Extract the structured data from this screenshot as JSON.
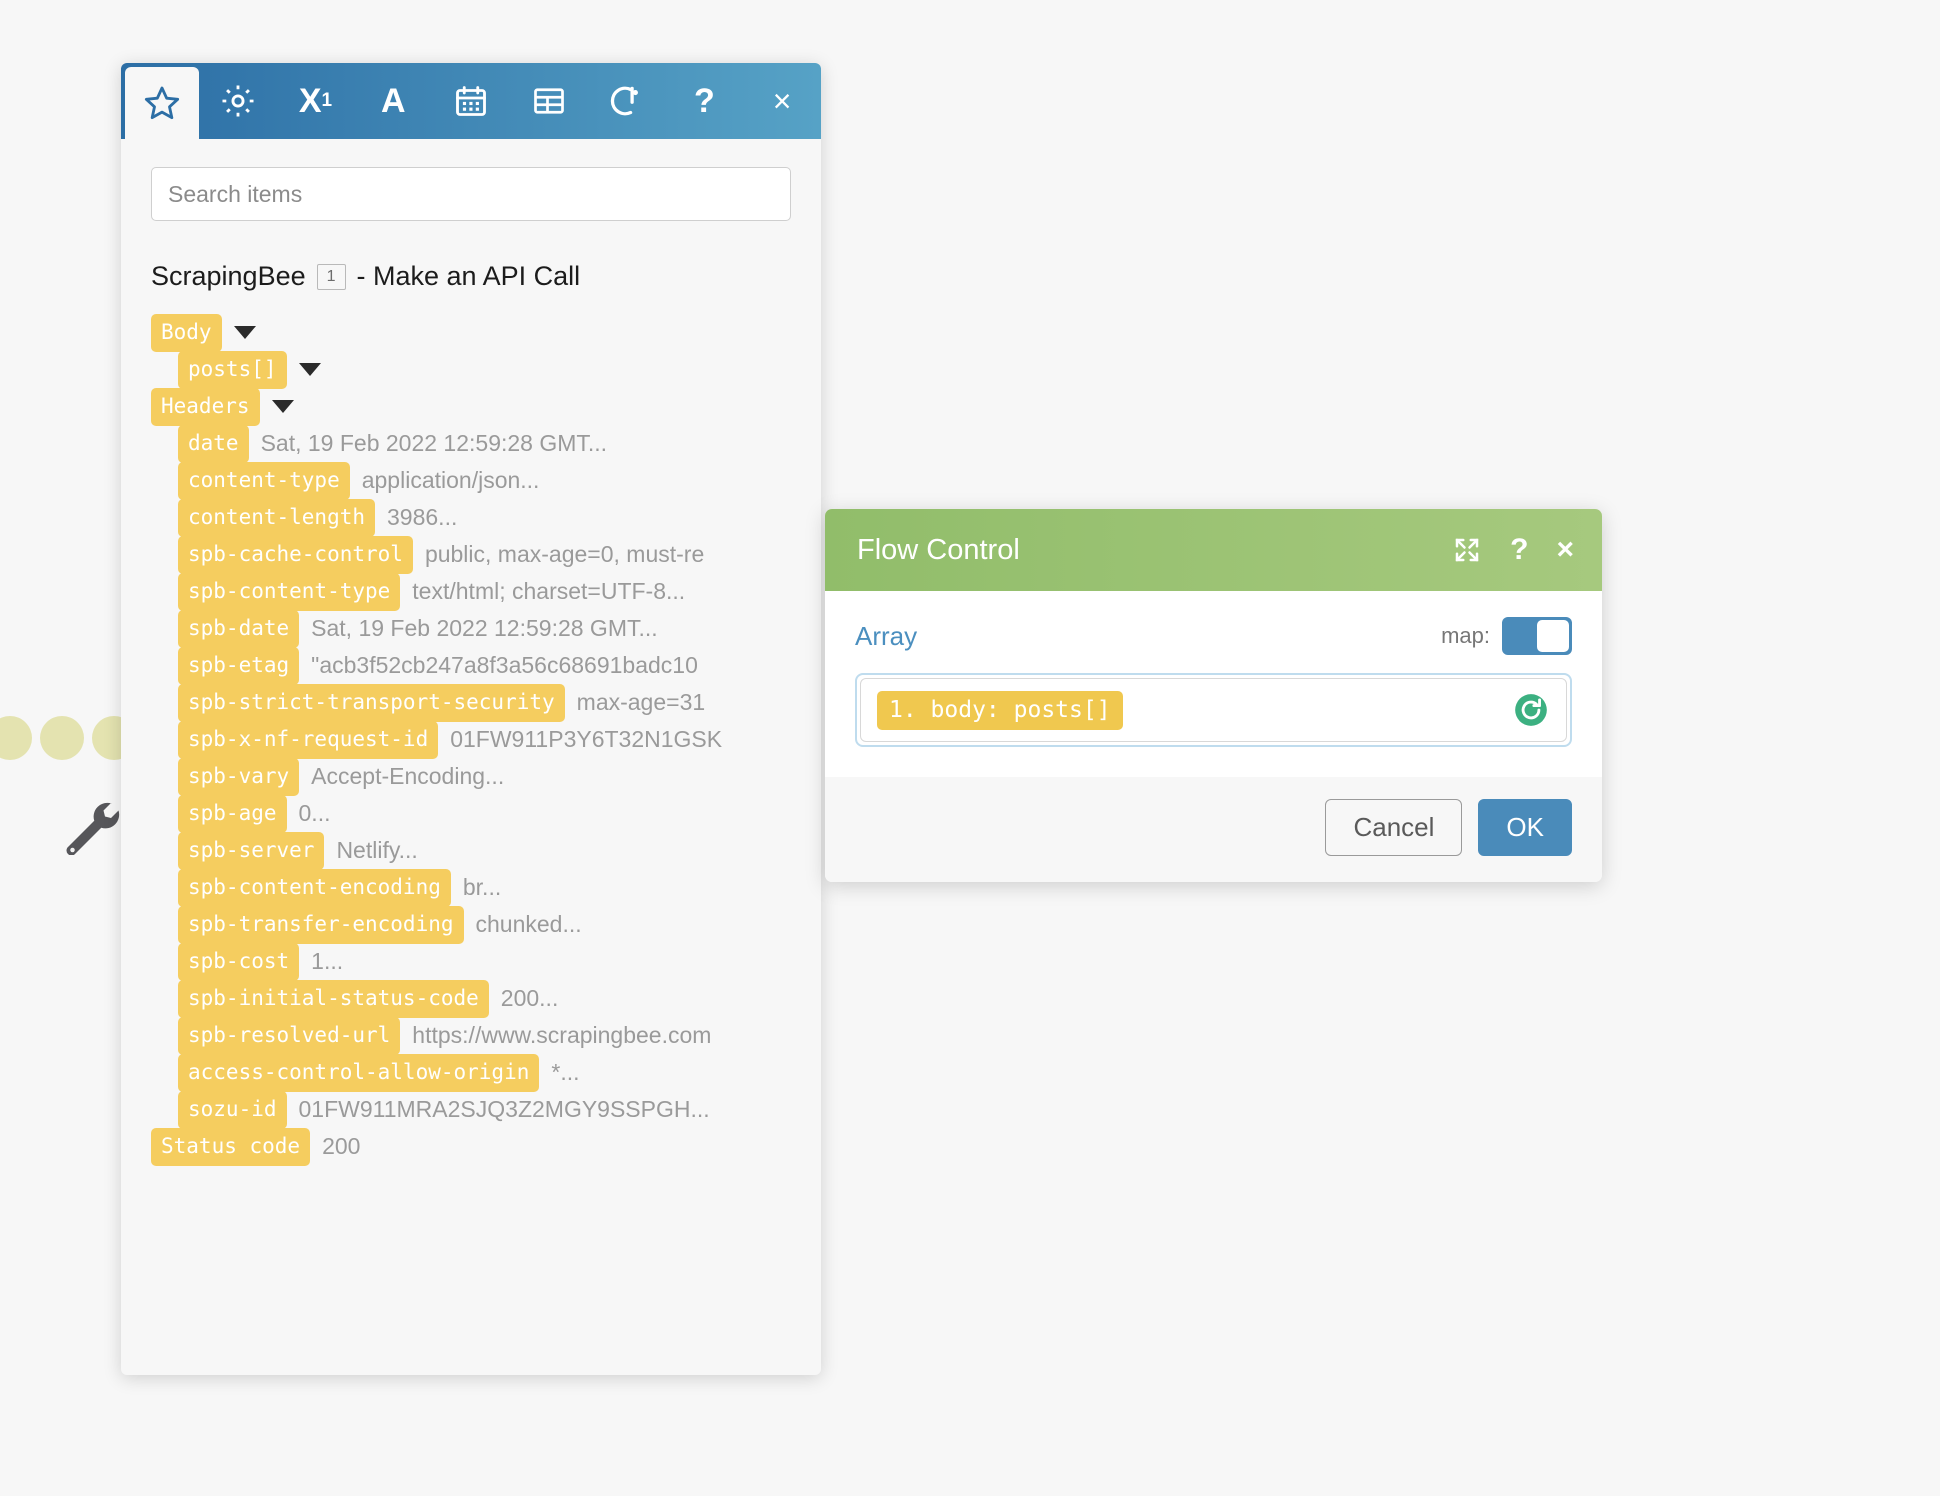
{
  "picker": {
    "tabs": [
      {
        "name": "tab-favorites",
        "icon": "star-icon",
        "active": true
      },
      {
        "name": "tab-settings",
        "icon": "gear-icon",
        "active": false
      },
      {
        "name": "tab-number",
        "icon": "x-superscript-one-icon",
        "label": "X",
        "sup": "1",
        "active": false
      },
      {
        "name": "tab-text",
        "icon": "letter-a-icon",
        "label": "A",
        "active": false
      },
      {
        "name": "tab-date",
        "icon": "calendar-icon",
        "active": false
      },
      {
        "name": "tab-table",
        "icon": "table-icon",
        "active": false
      },
      {
        "name": "tab-flow",
        "icon": "flow-control-icon",
        "active": false
      }
    ],
    "help_label": "?",
    "close_label": "×",
    "search": {
      "value": "",
      "placeholder": "Search items"
    },
    "node": {
      "name": "ScrapingBee",
      "badge": "1",
      "suffix": "- Make an API Call"
    },
    "tree": [
      {
        "chip": "Body",
        "value": "",
        "indent": 0,
        "caret": true
      },
      {
        "chip": "posts[]",
        "value": "",
        "indent": 1,
        "caret": true
      },
      {
        "chip": "Headers",
        "value": "",
        "indent": 0,
        "caret": true
      },
      {
        "chip": "date",
        "value": "Sat, 19 Feb 2022 12:59:28 GMT...",
        "indent": 1,
        "caret": false
      },
      {
        "chip": "content-type",
        "value": "application/json...",
        "indent": 1,
        "caret": false
      },
      {
        "chip": "content-length",
        "value": "3986...",
        "indent": 1,
        "caret": false
      },
      {
        "chip": "spb-cache-control",
        "value": "public, max-age=0, must-re",
        "indent": 1,
        "caret": false
      },
      {
        "chip": "spb-content-type",
        "value": "text/html; charset=UTF-8...",
        "indent": 1,
        "caret": false
      },
      {
        "chip": "spb-date",
        "value": "Sat, 19 Feb 2022 12:59:28 GMT...",
        "indent": 1,
        "caret": false
      },
      {
        "chip": "spb-etag",
        "value": "\"acb3f52cb247a8f3a56c68691badc10",
        "indent": 1,
        "caret": false
      },
      {
        "chip": "spb-strict-transport-security",
        "value": "max-age=31",
        "indent": 1,
        "caret": false
      },
      {
        "chip": "spb-x-nf-request-id",
        "value": "01FW911P3Y6T32N1GSK",
        "indent": 1,
        "caret": false
      },
      {
        "chip": "spb-vary",
        "value": "Accept-Encoding...",
        "indent": 1,
        "caret": false
      },
      {
        "chip": "spb-age",
        "value": "0...",
        "indent": 1,
        "caret": false
      },
      {
        "chip": "spb-server",
        "value": "Netlify...",
        "indent": 1,
        "caret": false
      },
      {
        "chip": "spb-content-encoding",
        "value": "br...",
        "indent": 1,
        "caret": false
      },
      {
        "chip": "spb-transfer-encoding",
        "value": "chunked...",
        "indent": 1,
        "caret": false
      },
      {
        "chip": "spb-cost",
        "value": "1...",
        "indent": 1,
        "caret": false
      },
      {
        "chip": "spb-initial-status-code",
        "value": "200...",
        "indent": 1,
        "caret": false
      },
      {
        "chip": "spb-resolved-url",
        "value": "https://www.scrapingbee.com",
        "indent": 1,
        "caret": false
      },
      {
        "chip": "access-control-allow-origin",
        "value": "*...",
        "indent": 1,
        "caret": false
      },
      {
        "chip": "sozu-id",
        "value": "01FW911MRA2SJQ3Z2MGY9SSPGH...",
        "indent": 1,
        "caret": false
      },
      {
        "chip": "Status code",
        "value": "200",
        "indent": 0,
        "caret": false
      }
    ]
  },
  "dialog": {
    "title": "Flow Control",
    "expand_label": "⤢",
    "help_label": "?",
    "close_label": "×",
    "array_label": "Array",
    "map_label": "map:",
    "map_on": true,
    "field_chip": "1. body: posts[]",
    "refresh_icon": "refresh-icon",
    "cancel_label": "Cancel",
    "ok_label": "OK"
  },
  "colors": {
    "chip_yellow": "#f5cd5f",
    "picker_header_blue": "#2c6ea5",
    "dialog_header_green": "#91bd6a",
    "accent_blue": "#4a8bba",
    "refresh_green": "#3cb081"
  }
}
